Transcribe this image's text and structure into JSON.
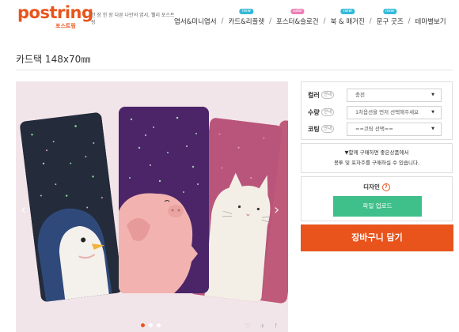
{
  "brand": {
    "logo_text": "postring",
    "logo_sub": "포스트링",
    "tagline": "한 장 한 장 다른 나만의 엽서, 웰리 포스트링"
  },
  "nav": [
    {
      "label": "엽서&미니엽서",
      "badge": ""
    },
    {
      "label": "카드&리플렛",
      "badge": "new"
    },
    {
      "label": "포스터&슬로건",
      "badge": "sale"
    },
    {
      "label": "북 & 매거진",
      "badge": "new"
    },
    {
      "label": "문구 굿즈",
      "badge": "new"
    },
    {
      "label": "테마별보기",
      "badge": ""
    }
  ],
  "product": {
    "title": "카드택 148x70㎜"
  },
  "options": {
    "color": {
      "label": "컬러",
      "help": "안내",
      "value": "충전"
    },
    "quantity": {
      "label": "수량",
      "help": "안내",
      "value": "1차옵션을 먼저 선택해주세요"
    },
    "coating": {
      "label": "코팅",
      "help": "안내",
      "value": "==코팅 선택=="
    }
  },
  "notice": {
    "line1": "▼함께 구매하면 좋은상품에서",
    "line2": "봉투 및 포자주를 구매하실 수 있습니다."
  },
  "design": {
    "title": "디자인",
    "help_symbol": "?",
    "upload_label": "파일 업로드"
  },
  "cart": {
    "label": "장바구니 담기"
  },
  "gallery": {
    "prev_symbol": "‹",
    "next_symbol": "›",
    "share_icons": [
      "♡",
      "✈",
      "f"
    ]
  },
  "colors": {
    "accent": "#e8541c",
    "upload": "#3fbf8a",
    "badge_new": "#35b9d8",
    "badge_sale": "#ee7fb7"
  }
}
